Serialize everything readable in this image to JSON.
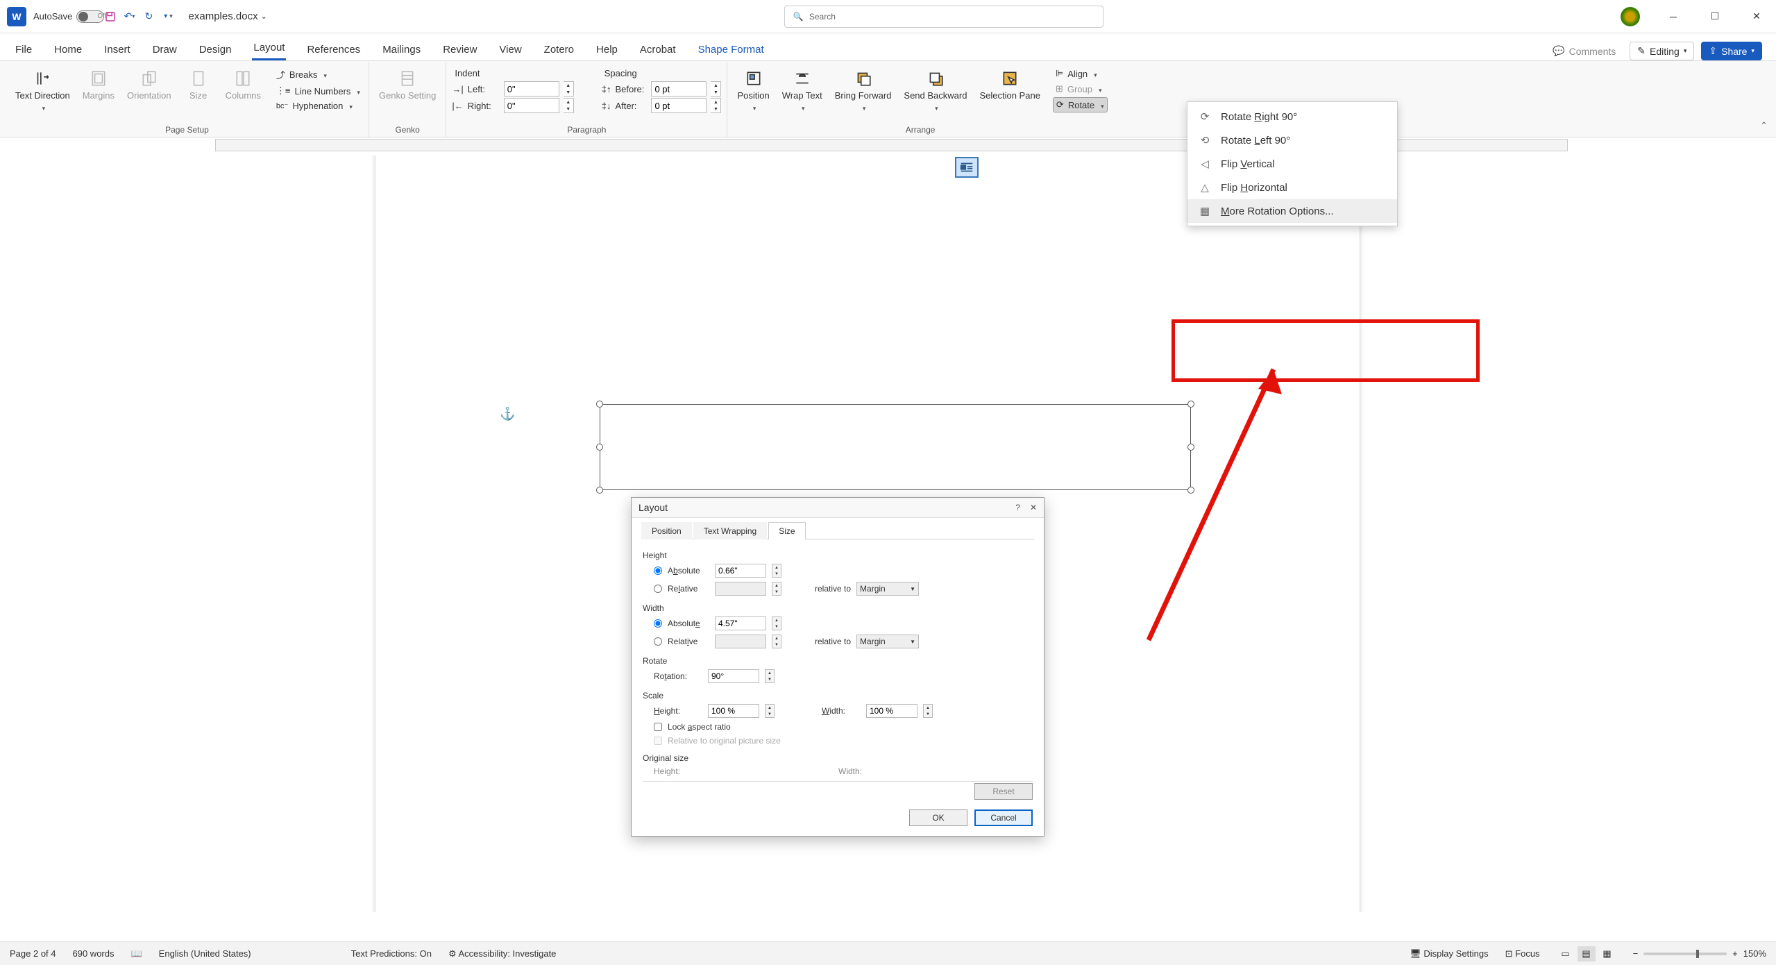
{
  "titlebar": {
    "autosave_label": "AutoSave",
    "autosave_state": "Off",
    "doc_title": "examples.docx",
    "search_placeholder": "Search"
  },
  "tabs": {
    "file": "File",
    "home": "Home",
    "insert": "Insert",
    "draw": "Draw",
    "design": "Design",
    "layout": "Layout",
    "references": "References",
    "mailings": "Mailings",
    "review": "Review",
    "view": "View",
    "zotero": "Zotero",
    "help": "Help",
    "acrobat": "Acrobat",
    "shape_format": "Shape Format"
  },
  "ribbon_right": {
    "comments": "Comments",
    "editing": "Editing",
    "share": "Share"
  },
  "ribbon": {
    "page_setup": {
      "group": "Page Setup",
      "text_direction": "Text Direction",
      "margins": "Margins",
      "orientation": "Orientation",
      "size": "Size",
      "columns": "Columns",
      "breaks": "Breaks",
      "line_numbers": "Line Numbers",
      "hyphenation": "Hyphenation"
    },
    "genko": {
      "group": "Genko",
      "btn": "Genko Setting"
    },
    "paragraph": {
      "group": "Paragraph",
      "indent": "Indent",
      "spacing": "Spacing",
      "left_label": "Left:",
      "right_label": "Right:",
      "before_label": "Before:",
      "after_label": "After:",
      "left_val": "0\"",
      "right_val": "0\"",
      "before_val": "0 pt",
      "after_val": "0 pt"
    },
    "arrange": {
      "group": "Arrange",
      "position": "Position",
      "wrap_text": "Wrap Text",
      "bring_forward": "Bring Forward",
      "send_backward": "Send Backward",
      "selection_pane": "Selection Pane",
      "align": "Align",
      "group_btn": "Group",
      "rotate": "Rotate"
    }
  },
  "rotate_menu": {
    "right90": "Rotate Right 90°",
    "left90": "Rotate Left 90°",
    "flipv": "Flip Vertical",
    "fliph": "Flip Horizontal",
    "more": "More Rotation Options..."
  },
  "dialog": {
    "title": "Layout",
    "tabs": {
      "position": "Position",
      "text_wrapping": "Text Wrapping",
      "size": "Size"
    },
    "height": {
      "section": "Height",
      "absolute": "Absolute",
      "relative": "Relative",
      "abs_val": "0.66\"",
      "relative_to": "relative to",
      "rel_target": "Margin"
    },
    "width": {
      "section": "Width",
      "absolute": "Absolute",
      "relative": "Relative",
      "abs_val": "4.57\"",
      "relative_to": "relative to",
      "rel_target": "Margin"
    },
    "rotate": {
      "section": "Rotate",
      "label": "Rotation:",
      "val": "90°"
    },
    "scale": {
      "section": "Scale",
      "h_label": "Height:",
      "w_label": "Width:",
      "h_val": "100 %",
      "w_val": "100 %",
      "lock": "Lock aspect ratio",
      "rel_orig": "Relative to original picture size"
    },
    "original": {
      "section": "Original size",
      "h_label": "Height:",
      "w_label": "Width:"
    },
    "reset": "Reset",
    "ok": "OK",
    "cancel": "Cancel"
  },
  "statusbar": {
    "page": "Page 2 of 4",
    "words": "690 words",
    "lang": "English (United States)",
    "pred": "Text Predictions: On",
    "access": "Accessibility: Investigate",
    "display": "Display Settings",
    "focus": "Focus",
    "zoom": "150%"
  }
}
